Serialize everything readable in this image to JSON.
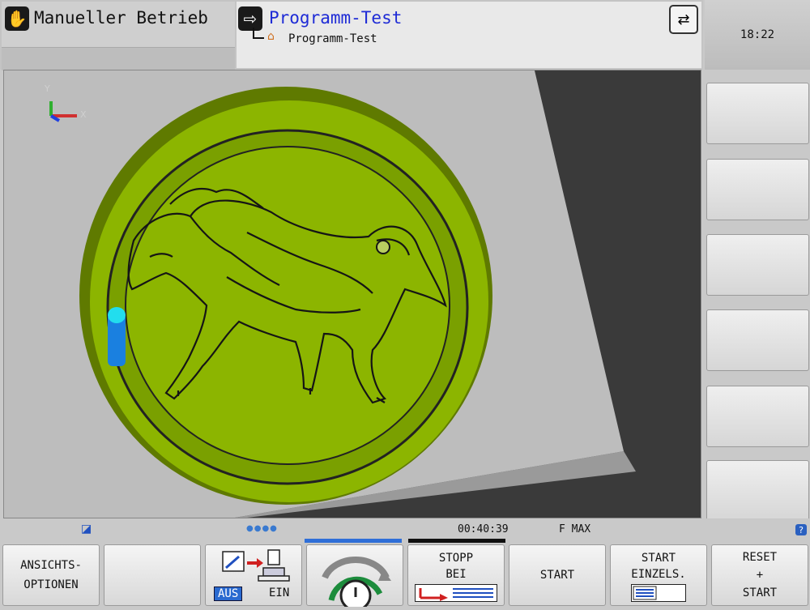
{
  "header": {
    "machine_mode": "Manueller Betrieb",
    "program_mode": "Programm-Test",
    "program_path": "Programm-Test",
    "clock": "18:22"
  },
  "icons": {
    "hand": "hand-icon",
    "arrow_in": "arrow-in-icon",
    "home": "home-icon",
    "swap": "swap-arrows-icon",
    "help": "help-icon"
  },
  "graphic": {
    "axes": {
      "x": "X",
      "y": "Y"
    }
  },
  "status": {
    "run_time": "00:40:39",
    "feed": "F MAX"
  },
  "softkeys": {
    "view_options_line1": "ANSICHTS-",
    "view_options_line2": "OPTIONEN",
    "aus": "AUS",
    "ein": "EIN",
    "stop_line1": "STOPP",
    "stop_line2": "BEI",
    "start": "START",
    "start_single_line1": "START",
    "start_single_line2": "EINZELS.",
    "reset_line1": "RESET",
    "reset_line2": "+",
    "reset_line3": "START"
  },
  "colors": {
    "part": "#8cb500",
    "part_dark": "#5a7400",
    "stock": "#bdbdbd",
    "tool": "#1a80e0",
    "tool_tip": "#22ddee",
    "title_blue": "#1e2bd6"
  }
}
